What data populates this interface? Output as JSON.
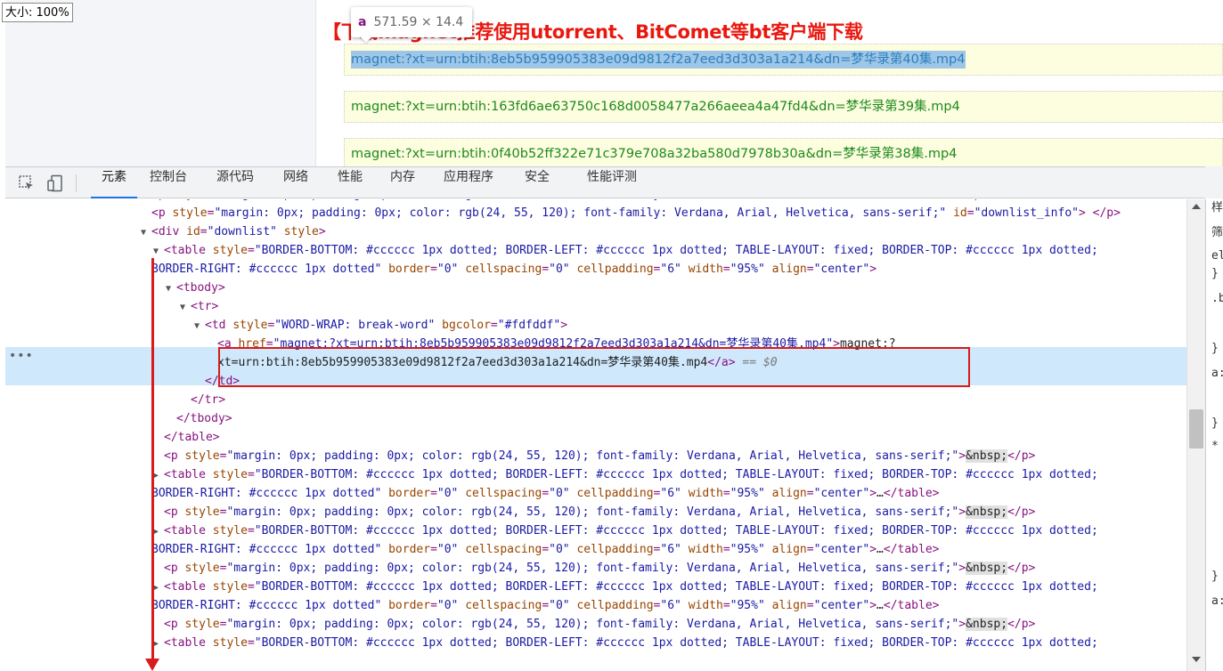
{
  "page": {
    "zoom_label": "大小: 100%",
    "heading": "【下载magnet推荐使用utorrent、BitComet等bt客户端下载",
    "links": [
      "magnet:?xt=urn:btih:8eb5b959905383e09d9812f2a7eed3d303a1a214&dn=梦华录第40集.mp4",
      "magnet:?xt=urn:btih:163fd6ae63750c168d0058477a266aeea4a47fd4&dn=梦华录第39集.mp4",
      "magnet:?xt=urn:btih:0f40b52ff322e71c379e708a32ba580d7978b30a&dn=梦华录第38集.mp4"
    ]
  },
  "tooltip": {
    "tag": "a",
    "size": "571.59 × 14.4"
  },
  "devtools": {
    "tabs": [
      "元素",
      "控制台",
      "源代码",
      "网络",
      "性能",
      "内存",
      "应用程序",
      "安全",
      "性能评测"
    ],
    "active_tab": "元素",
    "styles_pane": [
      "样",
      "筛",
      "el",
      "}",
      ".b",
      "}",
      "a:",
      "}",
      "*",
      "}",
      "a:"
    ]
  },
  "dom": {
    "p_style": "margin: 0px; padding: 0px; color: rgb(24, 55, 120); font-family: Verdana, Arial, Helvetica, sans-serif;",
    "p_id": "downlist_info",
    "div_id": "downlist",
    "table_style_1": "BORDER-BOTTOM: #cccccc 1px dotted; BORDER-LEFT: #cccccc 1px dotted; TABLE-LAYOUT: fixed; BORDER-TOP: #cccccc 1px dotted;",
    "table_style_2": "BORDER-RIGHT: #cccccc 1px dotted",
    "td_style": "WORD-WRAP: break-word",
    "td_bgcolor": "#fdfddf",
    "a_href": "magnet:?xt=urn:btih:8eb5b959905383e09d9812f2a7eed3d303a1a214&dn=梦华录第40集.mp4",
    "a_text_1": "magnet:?",
    "a_text_2": "xt=urn:btih:8eb5b959905383e09d9812f2a7eed3d303a1a214&dn=梦华录第40集.mp4",
    "selected_marker": "== $0",
    "nbsp": "&nbsp;",
    "ellipsis": "…"
  }
}
